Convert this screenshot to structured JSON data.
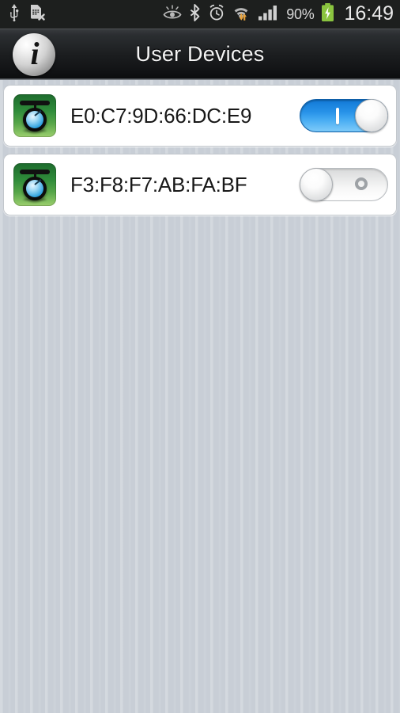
{
  "status_bar": {
    "left_icons": [
      {
        "name": "usb-icon",
        "label": "USB connected"
      },
      {
        "name": "no-sim-card-icon",
        "label": "No SIM card"
      }
    ],
    "right_icons": [
      {
        "name": "smart-stay-eye-icon",
        "label": "Smart stay"
      },
      {
        "name": "bluetooth-icon",
        "label": "Bluetooth on"
      },
      {
        "name": "alarm-clock-icon",
        "label": "Alarm set"
      },
      {
        "name": "wifi-icon",
        "label": "Wi-Fi connected with data transfer"
      },
      {
        "name": "cellular-signal-icon",
        "label": "Signal strength"
      }
    ],
    "battery_percent": "90%",
    "battery_state": "charging",
    "battery_color": "#8ac43f",
    "time": "16:49"
  },
  "action_bar": {
    "app_icon": "info-circle-icon",
    "app_icon_glyph": "i",
    "title": "User Devices"
  },
  "devices": [
    {
      "icon": "gauge-device-icon",
      "mac_address": "E0:C7:9D:66:DC:E9",
      "toggle_state": "on",
      "toggle_mark": "I"
    },
    {
      "icon": "gauge-device-icon",
      "mac_address": "F3:F8:F7:AB:FA:BF",
      "toggle_state": "off",
      "toggle_mark": "O"
    }
  ],
  "theme": {
    "background": "#c8ced6",
    "card_background": "#ffffff",
    "action_bar": "#1b1d1f",
    "switch_on_color": "#2792e8",
    "switch_off_color": "#eceded"
  }
}
